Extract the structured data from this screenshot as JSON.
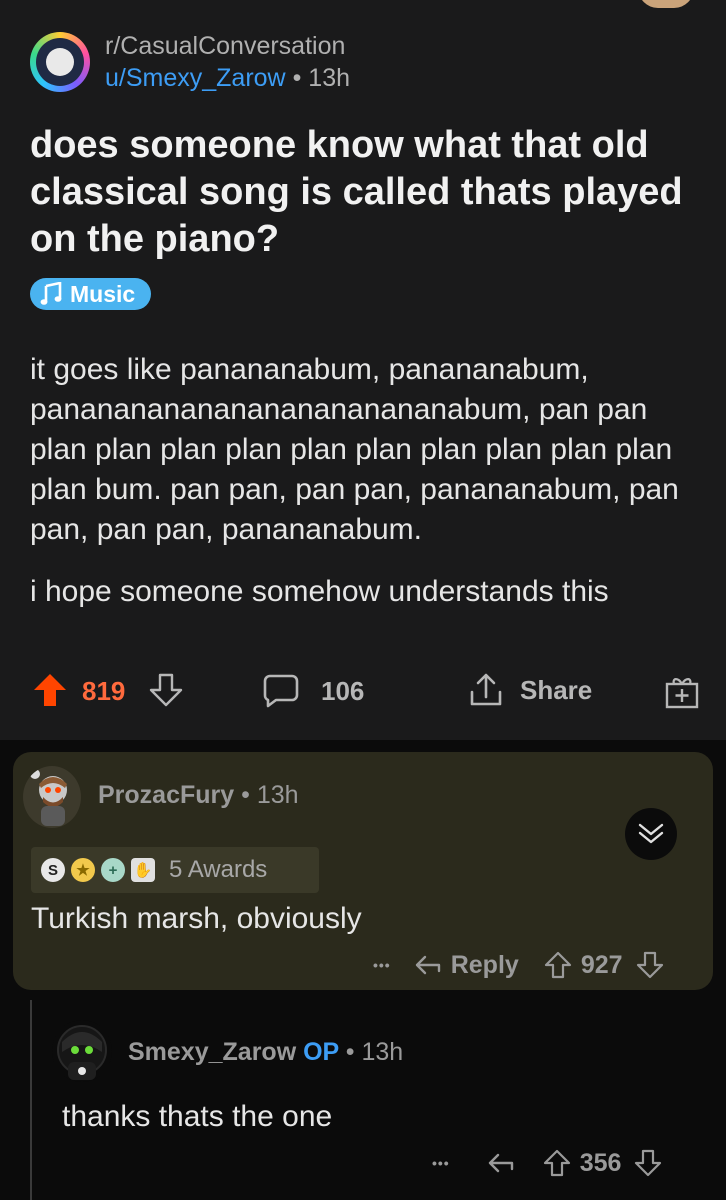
{
  "post": {
    "subreddit": "r/CasualConversation",
    "author": "u/Smexy_Zarow",
    "separator": "•",
    "time": "13h",
    "title": "does someone know what that old classical song is called thats played on the piano?",
    "flair": {
      "icon": "music-note-icon",
      "label": "Music"
    },
    "body": [
      "it goes like panananabum, panananabum, pananananananananananananabum, pan pan plan plan plan plan plan plan plan plan plan plan plan bum. pan pan, pan pan, panananabum, pan pan, pan pan, panananabum.",
      "i hope someone somehow understands this"
    ],
    "votes": "819",
    "comments": "106",
    "share_label": "Share"
  },
  "comments": [
    {
      "user": "ProzacFury",
      "separator": "•",
      "time": "13h",
      "awards_label": "5 Awards",
      "body": "Turkish marsh, obviously",
      "more": "•••",
      "reply_label": "Reply",
      "votes": "927"
    },
    {
      "user": "Smexy_Zarow",
      "op_label": "OP",
      "separator": "•",
      "time": "13h",
      "body": "thanks thats the one",
      "more": "•••",
      "votes": "356"
    }
  ],
  "colors": {
    "upvote": "#ff4500",
    "link": "#3d9df5",
    "flair": "#4ab3f0",
    "comment_highlight": "#2b2a1c"
  }
}
